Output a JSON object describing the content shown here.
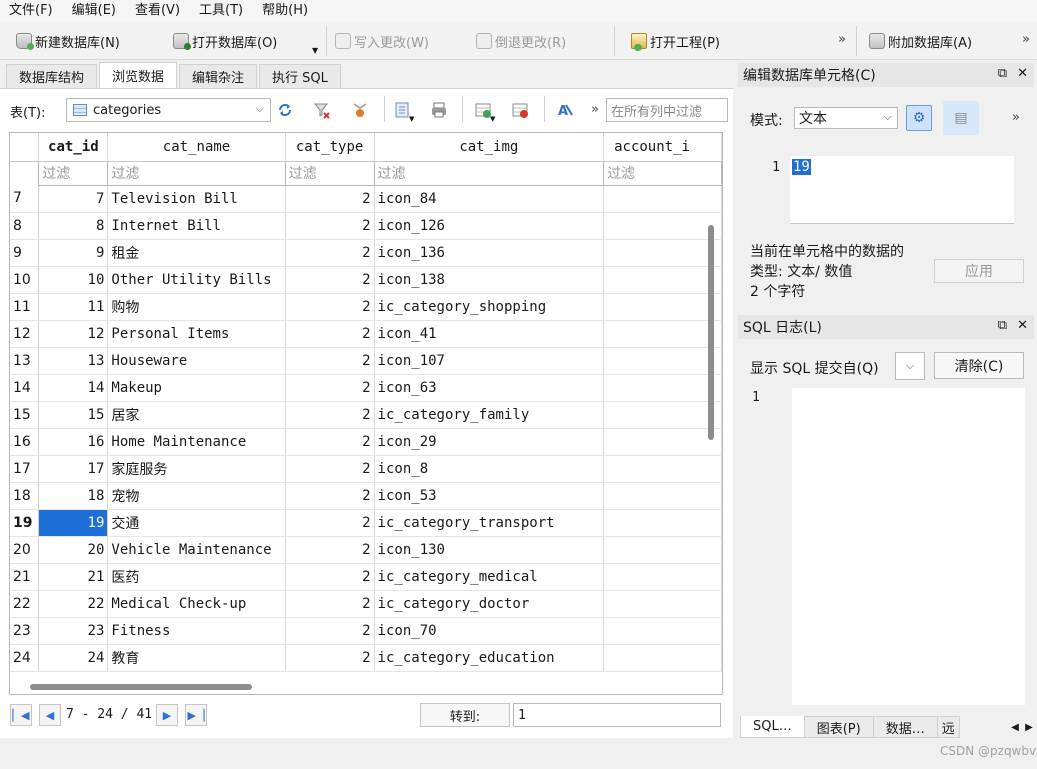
{
  "menu": [
    "文件(F)",
    "编辑(E)",
    "查看(V)",
    "工具(T)",
    "帮助(H)"
  ],
  "toolbar": {
    "new_db": "新建数据库(N)",
    "open_db": "打开数据库(O)",
    "write_changes": "写入更改(W)",
    "revert_changes": "倒退更改(R)",
    "open_project": "打开工程(P)",
    "attach_db": "附加数据库(A)",
    "more": "»"
  },
  "tabs": [
    "数据库结构",
    "浏览数据",
    "编辑杂注",
    "执行 SQL"
  ],
  "table_selector": {
    "label": "表(T):",
    "value": "categories",
    "filter_placeholder": "在所有列中过滤",
    "more": "»"
  },
  "grid": {
    "columns": [
      "cat_id",
      "cat_name",
      "cat_type",
      "cat_img",
      "account_i"
    ],
    "filter_placeholder": "过滤",
    "current_row_number": "19",
    "rows": [
      {
        "n": "7",
        "cat_id": "7",
        "cat_name": "Television Bill",
        "cat_type": "2",
        "cat_img": "icon_84"
      },
      {
        "n": "8",
        "cat_id": "8",
        "cat_name": "Internet Bill",
        "cat_type": "2",
        "cat_img": "icon_126"
      },
      {
        "n": "9",
        "cat_id": "9",
        "cat_name": "租金",
        "cat_type": "2",
        "cat_img": "icon_136"
      },
      {
        "n": "10",
        "cat_id": "10",
        "cat_name": "Other Utility Bills",
        "cat_type": "2",
        "cat_img": "icon_138"
      },
      {
        "n": "11",
        "cat_id": "11",
        "cat_name": "购物",
        "cat_type": "2",
        "cat_img": "ic_category_shopping"
      },
      {
        "n": "12",
        "cat_id": "12",
        "cat_name": "Personal Items",
        "cat_type": "2",
        "cat_img": "icon_41"
      },
      {
        "n": "13",
        "cat_id": "13",
        "cat_name": "Houseware",
        "cat_type": "2",
        "cat_img": "icon_107"
      },
      {
        "n": "14",
        "cat_id": "14",
        "cat_name": "Makeup",
        "cat_type": "2",
        "cat_img": "icon_63"
      },
      {
        "n": "15",
        "cat_id": "15",
        "cat_name": "居家",
        "cat_type": "2",
        "cat_img": "ic_category_family"
      },
      {
        "n": "16",
        "cat_id": "16",
        "cat_name": "Home Maintenance",
        "cat_type": "2",
        "cat_img": "icon_29"
      },
      {
        "n": "17",
        "cat_id": "17",
        "cat_name": "家庭服务",
        "cat_type": "2",
        "cat_img": "icon_8"
      },
      {
        "n": "18",
        "cat_id": "18",
        "cat_name": "宠物",
        "cat_type": "2",
        "cat_img": "icon_53"
      },
      {
        "n": "19",
        "cat_id": "19",
        "cat_name": "交通",
        "cat_type": "2",
        "cat_img": "ic_category_transport"
      },
      {
        "n": "20",
        "cat_id": "20",
        "cat_name": "Vehicle Maintenance",
        "cat_type": "2",
        "cat_img": "icon_130"
      },
      {
        "n": "21",
        "cat_id": "21",
        "cat_name": "医药",
        "cat_type": "2",
        "cat_img": "ic_category_medical"
      },
      {
        "n": "22",
        "cat_id": "22",
        "cat_name": "Medical Check-up",
        "cat_type": "2",
        "cat_img": "ic_category_doctor"
      },
      {
        "n": "23",
        "cat_id": "23",
        "cat_name": "Fitness",
        "cat_type": "2",
        "cat_img": "icon_70"
      },
      {
        "n": "24",
        "cat_id": "24",
        "cat_name": "教育",
        "cat_type": "2",
        "cat_img": "ic_category_education"
      }
    ]
  },
  "navigation": {
    "range_text": "7 - 24 / 41",
    "goto_label": "转到:",
    "goto_value": "1"
  },
  "cell_editor": {
    "title": "编辑数据库单元格(C)",
    "mode_label": "模式:",
    "mode_value": "文本",
    "line_number": "1",
    "content": "19",
    "info_line1": "当前在单元格中的数据的",
    "info_line2": "类型: 文本/ 数值",
    "info_line3": "2 个字符",
    "apply_label": "应用",
    "more": "»"
  },
  "sql_log": {
    "title": "SQL 日志(L)",
    "show_label": "显示 SQL 提交自(Q)",
    "clear_label": "清除(C)",
    "line_number": "1"
  },
  "bottom_tabs": [
    "SQL…",
    "图表(P)",
    "数据…",
    "远"
  ],
  "watermark": "CSDN @pzqwbv"
}
